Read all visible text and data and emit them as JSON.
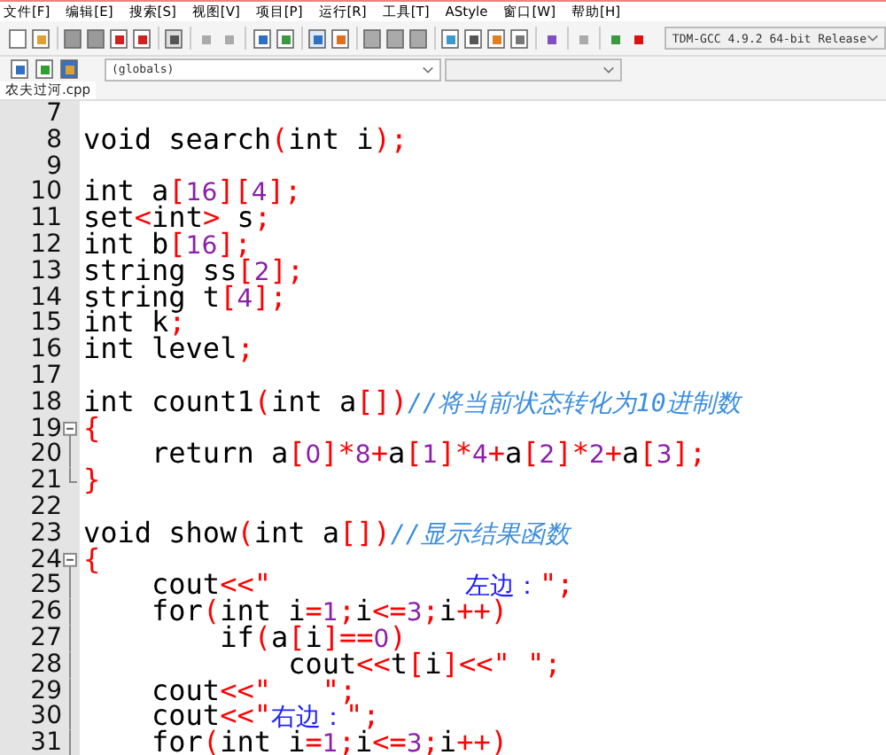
{
  "menu": [
    "文件[F]",
    "编辑[E]",
    "搜索[S]",
    "视图[V]",
    "项目[P]",
    "运行[R]",
    "工具[T]",
    "AStyle",
    "窗口[W]",
    "帮助[H]"
  ],
  "compiler": {
    "value": "TDM-GCC 4.9.2 64-bit Release"
  },
  "scope": {
    "value": "(globals)"
  },
  "tabs": [
    {
      "label": "农夫过河.cpp",
      "selected": true
    }
  ],
  "lines": [
    {
      "number": "7"
    },
    {
      "number": "8",
      "tokens": [
        {
          "kind": "plain",
          "text": "void search"
        },
        {
          "kind": "sym",
          "text": "("
        },
        {
          "kind": "plain",
          "text": "int i"
        },
        {
          "kind": "sym",
          "text": ");"
        }
      ]
    },
    {
      "number": "9"
    },
    {
      "number": "10",
      "tokens": [
        {
          "kind": "plain",
          "text": "int a"
        },
        {
          "kind": "sym",
          "text": "["
        },
        {
          "kind": "num",
          "text": "16"
        },
        {
          "kind": "sym",
          "text": "]["
        },
        {
          "kind": "num",
          "text": "4"
        },
        {
          "kind": "sym",
          "text": "];"
        }
      ]
    },
    {
      "number": "11",
      "tokens": [
        {
          "kind": "plain",
          "text": "set"
        },
        {
          "kind": "sym",
          "text": "<"
        },
        {
          "kind": "plain",
          "text": "int"
        },
        {
          "kind": "sym",
          "text": ">"
        },
        {
          "kind": "plain",
          "text": " s"
        },
        {
          "kind": "sym",
          "text": ";"
        }
      ]
    },
    {
      "number": "12",
      "tokens": [
        {
          "kind": "plain",
          "text": "int b"
        },
        {
          "kind": "sym",
          "text": "["
        },
        {
          "kind": "num",
          "text": "16"
        },
        {
          "kind": "sym",
          "text": "];"
        }
      ]
    },
    {
      "number": "13",
      "tokens": [
        {
          "kind": "plain",
          "text": "string ss"
        },
        {
          "kind": "sym",
          "text": "["
        },
        {
          "kind": "num",
          "text": "2"
        },
        {
          "kind": "sym",
          "text": "];"
        }
      ]
    },
    {
      "number": "14",
      "tokens": [
        {
          "kind": "plain",
          "text": "string t"
        },
        {
          "kind": "sym",
          "text": "["
        },
        {
          "kind": "num",
          "text": "4"
        },
        {
          "kind": "sym",
          "text": "];"
        }
      ]
    },
    {
      "number": "15",
      "tokens": [
        {
          "kind": "plain",
          "text": "int k"
        },
        {
          "kind": "sym",
          "text": ";"
        }
      ]
    },
    {
      "number": "16",
      "tokens": [
        {
          "kind": "plain",
          "text": "int level"
        },
        {
          "kind": "sym",
          "text": ";"
        }
      ]
    },
    {
      "number": "17"
    },
    {
      "number": "18",
      "tokens": [
        {
          "kind": "plain",
          "text": "int count1"
        },
        {
          "kind": "sym",
          "text": "("
        },
        {
          "kind": "plain",
          "text": "int a"
        },
        {
          "kind": "sym",
          "text": "[])"
        },
        {
          "kind": "comment",
          "text": "//将当前状态转化为10进制数"
        }
      ]
    },
    {
      "number": "19",
      "kind": "fold-start",
      "tokens": [
        {
          "kind": "sym",
          "text": "{"
        }
      ]
    },
    {
      "number": "20",
      "kind": "fold-body",
      "tokens": [
        {
          "kind": "plain",
          "text": "    return a"
        },
        {
          "kind": "sym",
          "text": "["
        },
        {
          "kind": "num",
          "text": "0"
        },
        {
          "kind": "sym",
          "text": "]*"
        },
        {
          "kind": "num",
          "text": "8"
        },
        {
          "kind": "sym",
          "text": "+"
        },
        {
          "kind": "plain",
          "text": "a"
        },
        {
          "kind": "sym",
          "text": "["
        },
        {
          "kind": "num",
          "text": "1"
        },
        {
          "kind": "sym",
          "text": "]*"
        },
        {
          "kind": "num",
          "text": "4"
        },
        {
          "kind": "sym",
          "text": "+"
        },
        {
          "kind": "plain",
          "text": "a"
        },
        {
          "kind": "sym",
          "text": "["
        },
        {
          "kind": "num",
          "text": "2"
        },
        {
          "kind": "sym",
          "text": "]*"
        },
        {
          "kind": "num",
          "text": "2"
        },
        {
          "kind": "sym",
          "text": "+"
        },
        {
          "kind": "plain",
          "text": "a"
        },
        {
          "kind": "sym",
          "text": "["
        },
        {
          "kind": "num",
          "text": "3"
        },
        {
          "kind": "sym",
          "text": "];"
        }
      ]
    },
    {
      "number": "21",
      "kind": "fold-end",
      "tokens": [
        {
          "kind": "sym",
          "text": "}"
        }
      ]
    },
    {
      "number": "22"
    },
    {
      "number": "23",
      "tokens": [
        {
          "kind": "plain",
          "text": "void show"
        },
        {
          "kind": "sym",
          "text": "("
        },
        {
          "kind": "plain",
          "text": "int a"
        },
        {
          "kind": "sym",
          "text": "[])"
        },
        {
          "kind": "comment",
          "text": "//显示结果函数"
        }
      ]
    },
    {
      "number": "24",
      "kind": "fold-start",
      "tokens": [
        {
          "kind": "sym",
          "text": "{"
        }
      ]
    },
    {
      "number": "25",
      "kind": "fold-body",
      "tokens": [
        {
          "kind": "plain",
          "text": "    cout"
        },
        {
          "kind": "sym",
          "text": "<<\""
        },
        {
          "kind": "str",
          "text": "             左边："
        },
        {
          "kind": "sym",
          "text": "\";"
        }
      ]
    },
    {
      "number": "26",
      "kind": "fold-body",
      "tokens": [
        {
          "kind": "plain",
          "text": "    for"
        },
        {
          "kind": "sym",
          "text": "("
        },
        {
          "kind": "plain",
          "text": "int i"
        },
        {
          "kind": "sym",
          "text": "="
        },
        {
          "kind": "num",
          "text": "1"
        },
        {
          "kind": "sym",
          "text": ";"
        },
        {
          "kind": "plain",
          "text": "i"
        },
        {
          "kind": "sym",
          "text": "<="
        },
        {
          "kind": "num",
          "text": "3"
        },
        {
          "kind": "sym",
          "text": ";"
        },
        {
          "kind": "plain",
          "text": "i"
        },
        {
          "kind": "sym",
          "text": "++)"
        }
      ]
    },
    {
      "number": "27",
      "kind": "fold-body",
      "tokens": [
        {
          "kind": "plain",
          "text": "        if"
        },
        {
          "kind": "sym",
          "text": "("
        },
        {
          "kind": "plain",
          "text": "a"
        },
        {
          "kind": "sym",
          "text": "["
        },
        {
          "kind": "plain",
          "text": "i"
        },
        {
          "kind": "sym",
          "text": "]=="
        },
        {
          "kind": "num",
          "text": "0"
        },
        {
          "kind": "sym",
          "text": ")"
        }
      ]
    },
    {
      "number": "28",
      "kind": "fold-body",
      "tokens": [
        {
          "kind": "plain",
          "text": "            cout"
        },
        {
          "kind": "sym",
          "text": "<<"
        },
        {
          "kind": "plain",
          "text": "t"
        },
        {
          "kind": "sym",
          "text": "["
        },
        {
          "kind": "plain",
          "text": "i"
        },
        {
          "kind": "sym",
          "text": "]<<\" \";"
        }
      ]
    },
    {
      "number": "29",
      "kind": "fold-body",
      "tokens": [
        {
          "kind": "plain",
          "text": "    cout"
        },
        {
          "kind": "sym",
          "text": "<<\"   \";"
        }
      ]
    },
    {
      "number": "30",
      "kind": "fold-body",
      "tokens": [
        {
          "kind": "plain",
          "text": "    cout"
        },
        {
          "kind": "sym",
          "text": "<<\""
        },
        {
          "kind": "str",
          "text": "右边："
        },
        {
          "kind": "sym",
          "text": "\";"
        }
      ]
    },
    {
      "number": "31",
      "kind": "fold-body",
      "tokens": [
        {
          "kind": "plain",
          "text": "    for"
        },
        {
          "kind": "sym",
          "text": "("
        },
        {
          "kind": "plain",
          "text": "int i"
        },
        {
          "kind": "sym",
          "text": "="
        },
        {
          "kind": "num",
          "text": "1"
        },
        {
          "kind": "sym",
          "text": ";"
        },
        {
          "kind": "plain",
          "text": "i"
        },
        {
          "kind": "sym",
          "text": "<="
        },
        {
          "kind": "num",
          "text": "3"
        },
        {
          "kind": "sym",
          "text": ";"
        },
        {
          "kind": "plain",
          "text": "i"
        },
        {
          "kind": "sym",
          "text": "++)"
        }
      ]
    }
  ]
}
